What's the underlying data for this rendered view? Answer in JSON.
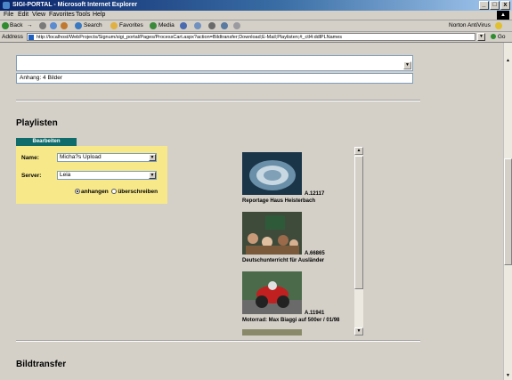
{
  "window": {
    "title": "SIGI-PORTAL - Microsoft Internet Explorer",
    "controls": [
      "_",
      "□",
      "x"
    ]
  },
  "menu": [
    "File",
    "Edit",
    "View",
    "Favorites",
    "Tools",
    "Help"
  ],
  "toolbar": {
    "back": "Back",
    "forward": "→",
    "search": "Search",
    "favorites": "Favorites",
    "media": "Media",
    "norton": "Norton AntiVirus"
  },
  "address": {
    "label": "Address",
    "url": "http://localhost/WebProjects/Signum/sigi_portal/Pages/ProcessCart.aspx?action=Bildtransfer;Download;E-Mail;Playlisten;#_ctl4:ddlPLNames",
    "go": "Go"
  },
  "attachment": {
    "text": "Anhang: 4 Bilder"
  },
  "playlists": {
    "heading": "Playlisten",
    "edit_tab": "Bearbeiten",
    "name_label": "Name:",
    "name_value": "Micha?s Upload",
    "server_label": "Server:",
    "server_value": "Leia",
    "radio_append": "anhangen",
    "radio_overwrite": "überschreiben",
    "radio_selected": "anhangen"
  },
  "images": [
    {
      "id": "A.12117",
      "caption": "Reportage Haus Heisterbach"
    },
    {
      "id": "A.66865",
      "caption": "Deutschunterricht für Ausländer"
    },
    {
      "id": "A.11941",
      "caption": "Motorrad: Max Biaggi auf 500er / 01/98"
    }
  ],
  "bildtransfer": {
    "heading": "Bildtransfer"
  },
  "colors": {
    "panel_bg": "#f7e88a",
    "tab_bg": "#0f6c6a",
    "page_bg": "#d4d0c8"
  }
}
